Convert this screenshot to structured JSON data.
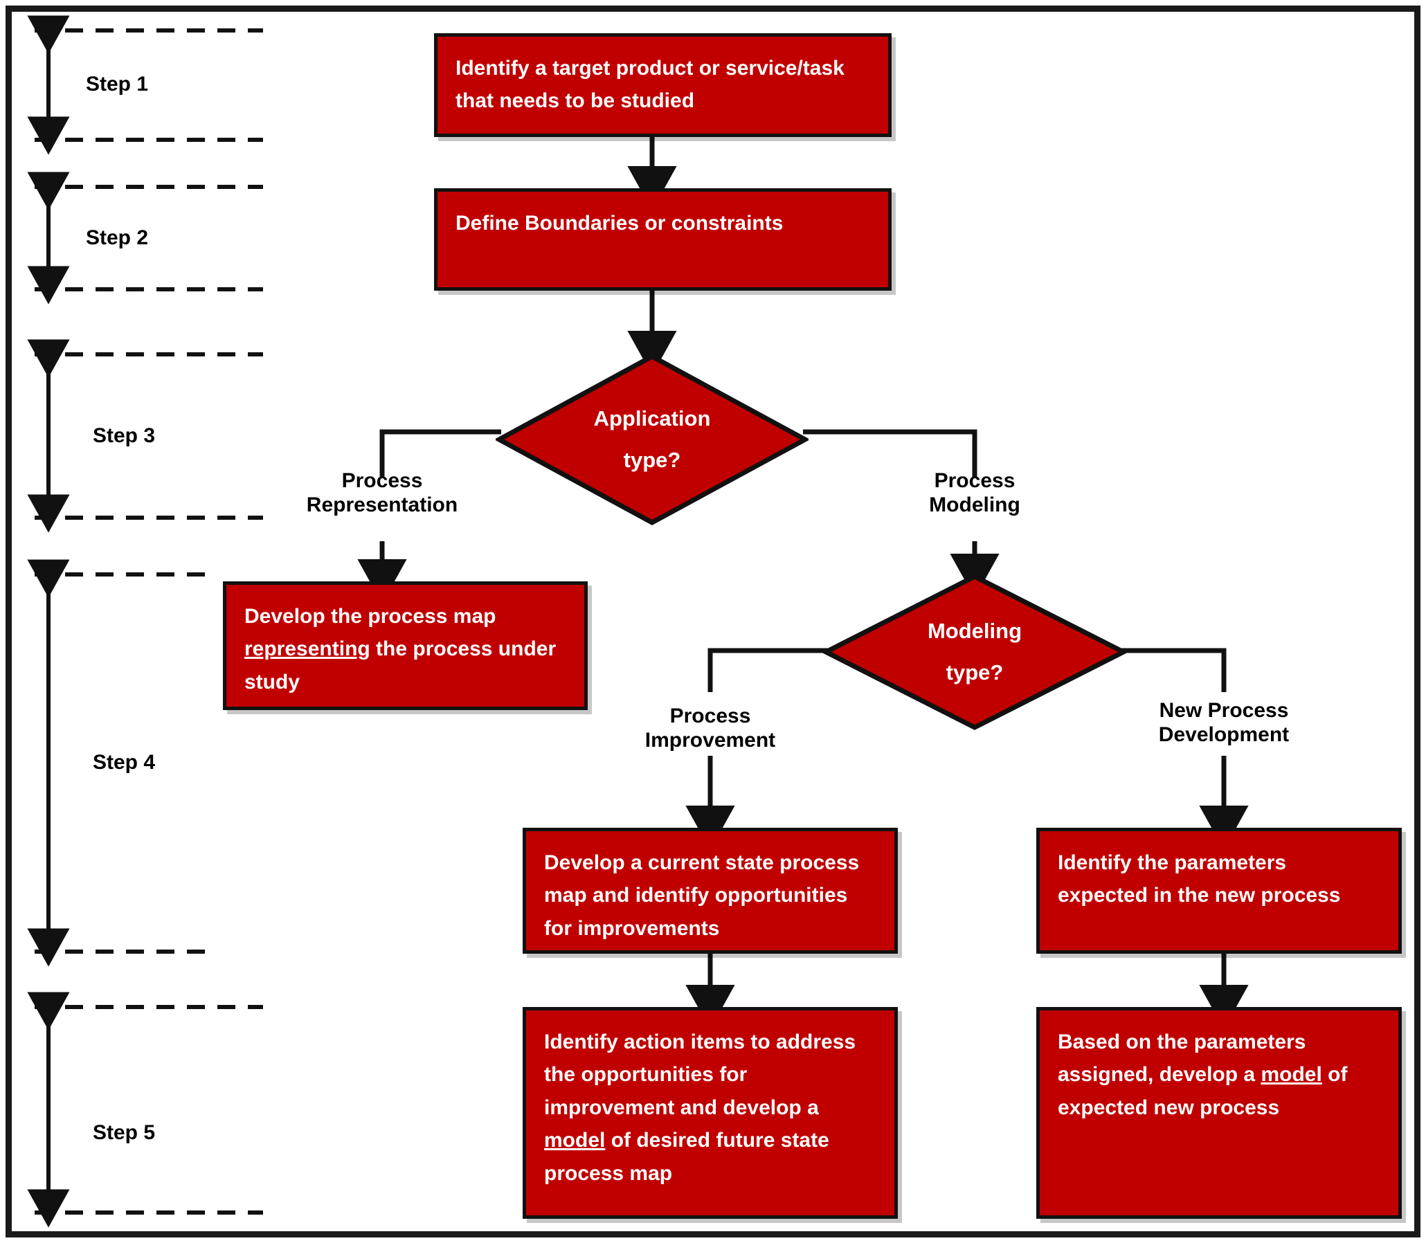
{
  "diagram": {
    "title": "Process mapping and modeling methodology flowchart",
    "accent_color": "#C00000",
    "line_color": "#111111",
    "text_on_accent": "#FFFFFF"
  },
  "steps": [
    {
      "id": "step1",
      "label": "Step 1"
    },
    {
      "id": "step2",
      "label": "Step 2"
    },
    {
      "id": "step3",
      "label": "Step 3"
    },
    {
      "id": "step4",
      "label": "Step 4"
    },
    {
      "id": "step5",
      "label": "Step 5"
    }
  ],
  "nodes": {
    "identify_target": {
      "type": "process",
      "text": "Identify a target product or service/task that needs to be studied"
    },
    "define_boundaries": {
      "type": "process",
      "text": "Define Boundaries or constraints"
    },
    "application_type": {
      "type": "decision",
      "line1": "Application",
      "line2": "type?"
    },
    "modeling_type": {
      "type": "decision",
      "line1": "Modeling",
      "line2": "type?"
    },
    "develop_process_map": {
      "type": "process",
      "text_before": "Develop the process map ",
      "text_underlined": "representing",
      "text_after": " the process under study"
    },
    "current_state_map": {
      "type": "process",
      "text": "Develop a current state process map and identify opportunities for improvements"
    },
    "identify_parameters": {
      "type": "process",
      "text": "Identify the parameters expected in the new process"
    },
    "action_items": {
      "type": "process",
      "text_before": "Identify action items to address the opportunities for improvement and develop a ",
      "text_underlined": "model",
      "text_after": " of desired future state process map"
    },
    "based_on_parameters": {
      "type": "process",
      "text_before": "Based on the parameters assigned, develop a ",
      "text_underlined": "model",
      "text_after": " of expected new process"
    }
  },
  "edge_labels": {
    "process_representation": "Process\nRepresentation",
    "process_modeling": "Process\nModeling",
    "process_improvement": "Process\nImprovement",
    "new_process_development": "New Process\nDevelopment"
  }
}
